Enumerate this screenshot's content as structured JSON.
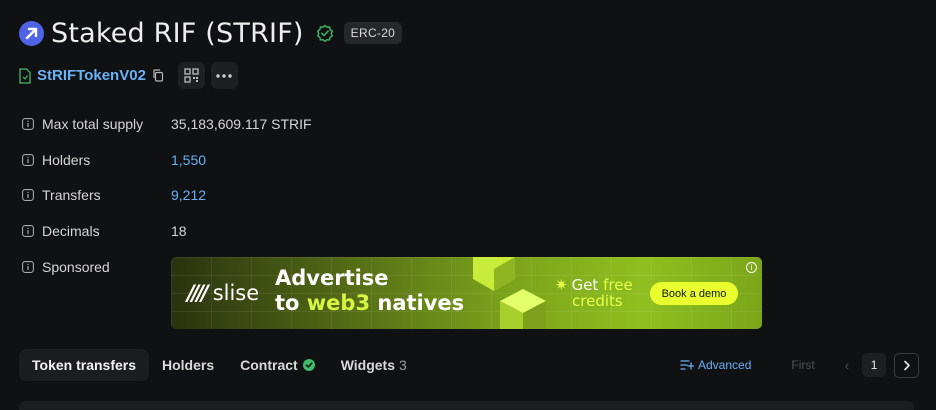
{
  "token": {
    "name": "Staked RIF (STRIF)",
    "type_badge": "ERC-20",
    "contract_name": "StRIFTokenV02"
  },
  "details": [
    {
      "label": "Max total supply",
      "value": "35,183,609.117 STRIF"
    },
    {
      "label": "Holders",
      "value": "1,550"
    },
    {
      "label": "Transfers",
      "value": "9,212"
    },
    {
      "label": "Decimals",
      "value": "18"
    },
    {
      "label": "Sponsored",
      "value": ""
    }
  ],
  "banner": {
    "logo_bars": "////",
    "logo_text": "slise",
    "headline_line1": "Advertise",
    "headline_to": "to ",
    "headline_accent": "web3",
    "headline_rest": " natives",
    "offer_star": "✷",
    "offer_get": "Get ",
    "offer_free": "free",
    "offer_credits": "credits",
    "cta": "Book a demo",
    "info": "i"
  },
  "tabs": [
    {
      "label": "Token transfers",
      "active": true
    },
    {
      "label": "Holders"
    },
    {
      "label": "Contract"
    },
    {
      "label": "Widgets",
      "count": "3"
    }
  ],
  "pagination": {
    "advanced_label": "Advanced",
    "first_label": "First",
    "prev_glyph": "‹",
    "current_page": "1"
  },
  "colors": {
    "background": "#101112",
    "link": "#6ab0f5",
    "verified": "#3fb96b",
    "banner_accent": "#e9ff2e",
    "token_logo": "#4f63e6"
  }
}
